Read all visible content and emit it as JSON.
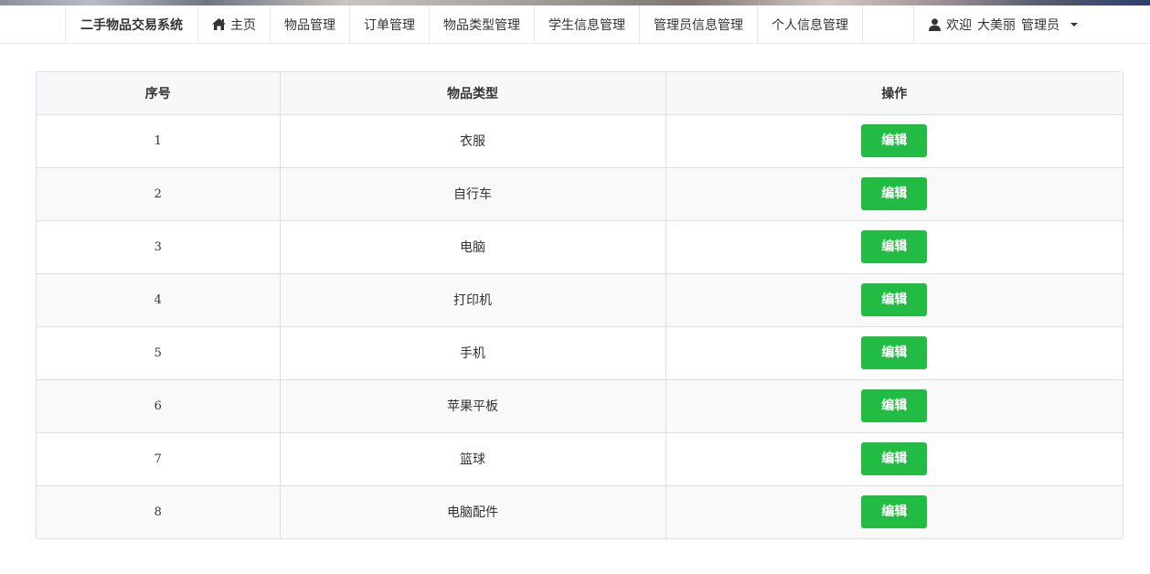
{
  "nav": {
    "brand": "二手物品交易系统",
    "items": [
      {
        "label": "主页",
        "icon": "home-icon"
      },
      {
        "label": "物品管理"
      },
      {
        "label": "订单管理"
      },
      {
        "label": "物品类型管理"
      },
      {
        "label": "学生信息管理"
      },
      {
        "label": "管理员信息管理"
      },
      {
        "label": "个人信息管理"
      }
    ],
    "user": {
      "icon": "user-icon",
      "welcome": "欢迎",
      "name": "大美丽",
      "role": "管理员"
    }
  },
  "table": {
    "headers": [
      "序号",
      "物品类型",
      "操作"
    ],
    "rows": [
      {
        "index": "1",
        "type": "衣服",
        "action": "编辑"
      },
      {
        "index": "2",
        "type": "自行车",
        "action": "编辑"
      },
      {
        "index": "3",
        "type": "电脑",
        "action": "编辑"
      },
      {
        "index": "4",
        "type": "打印机",
        "action": "编辑"
      },
      {
        "index": "5",
        "type": "手机",
        "action": "编辑"
      },
      {
        "index": "6",
        "type": "苹果平板",
        "action": "编辑"
      },
      {
        "index": "7",
        "type": "篮球",
        "action": "编辑"
      },
      {
        "index": "8",
        "type": "电脑配件",
        "action": "编辑"
      }
    ]
  },
  "colors": {
    "edit_button": "#22bb44",
    "header_bg": "#f7f8fa",
    "border": "#dddddd"
  }
}
